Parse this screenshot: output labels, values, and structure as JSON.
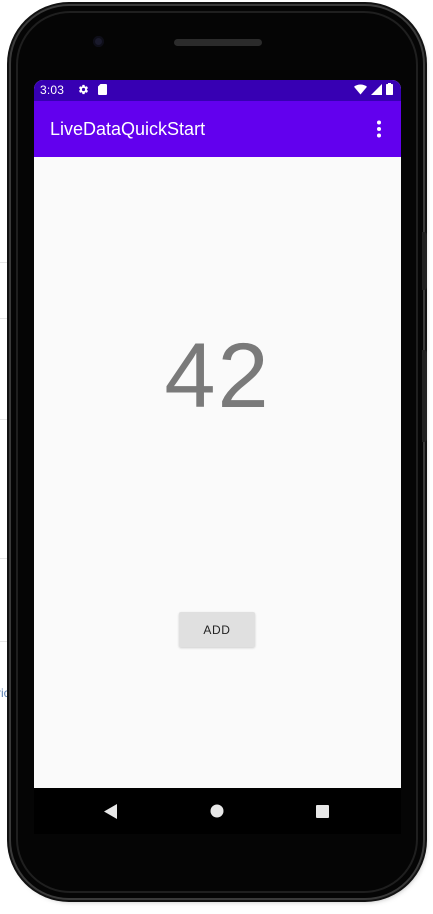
{
  "status_bar": {
    "time": "3:03",
    "icons": [
      "settings-icon",
      "sd-card-icon",
      "wifi-icon",
      "signal-icon",
      "battery-icon"
    ],
    "background": "#3700b3"
  },
  "app_bar": {
    "title": "LiveDataQuickStart",
    "menu_icon": "more-vert-icon",
    "background": "#6200ee"
  },
  "main": {
    "counter_value": "42",
    "add_button_label": "ADD"
  },
  "nav_bar": {
    "buttons": [
      "back-icon",
      "home-icon",
      "recents-icon"
    ]
  },
  "background_page": {
    "fragment_text": "ric"
  }
}
